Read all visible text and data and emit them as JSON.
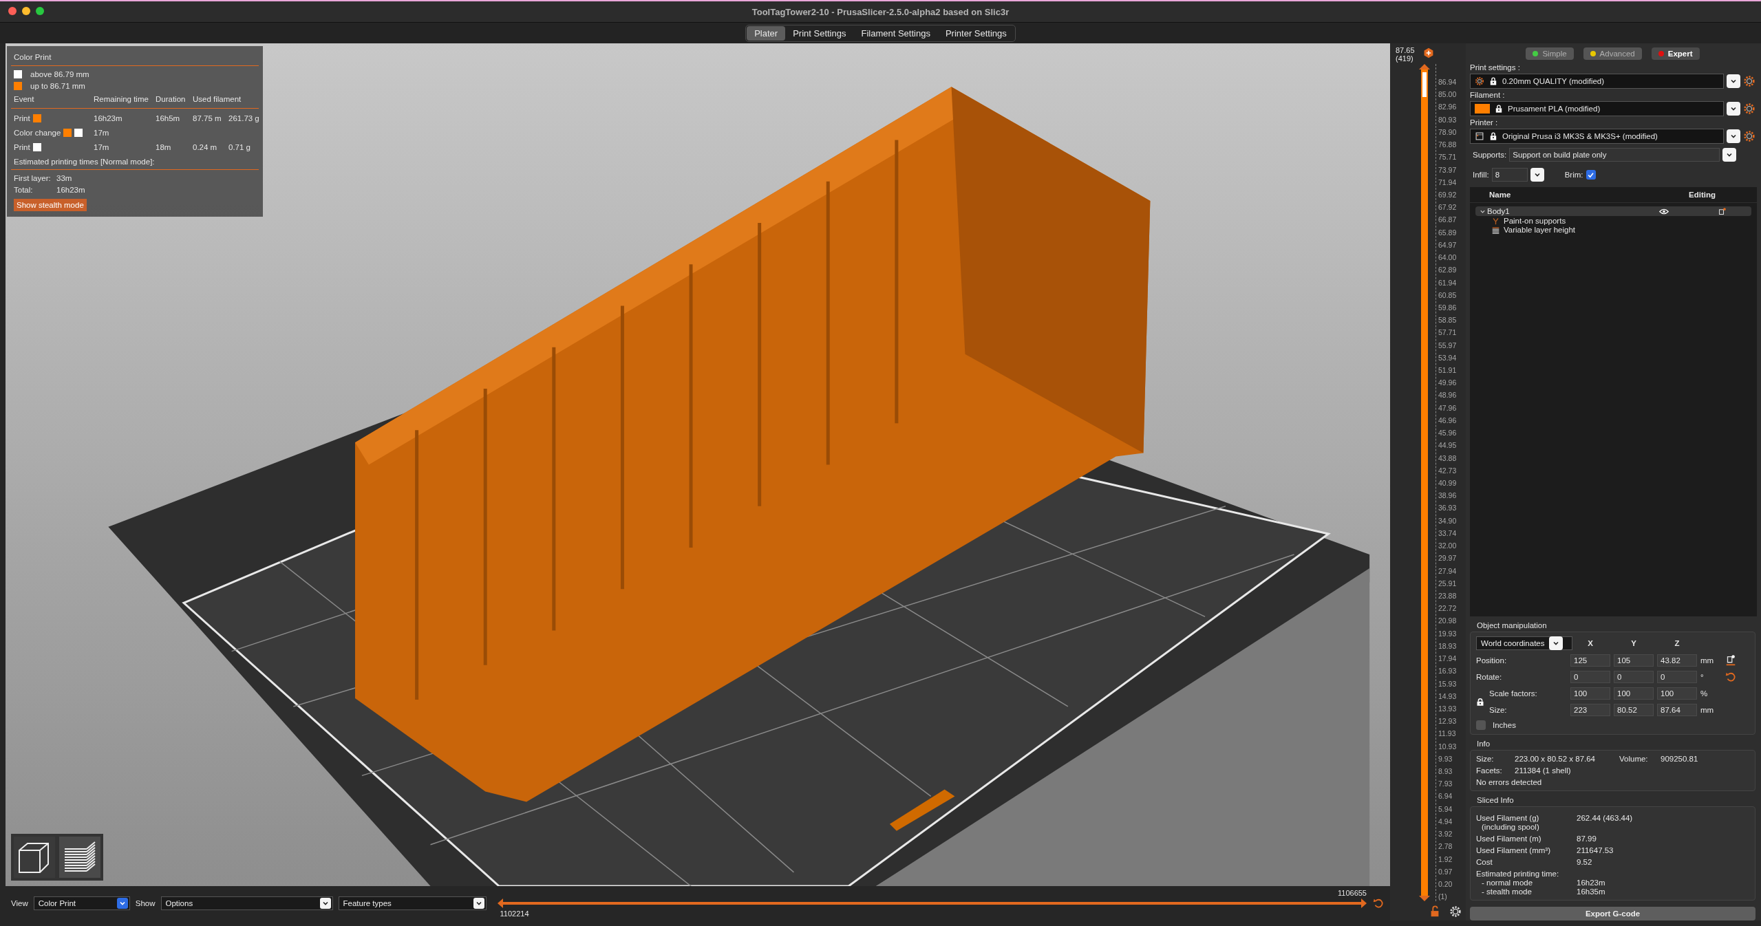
{
  "window": {
    "title": "ToolTagTower2-10 - PrusaSlicer-2.5.0-alpha2 based on Slic3r"
  },
  "tabs": [
    {
      "label": "Plater",
      "selected": true
    },
    {
      "label": "Print Settings",
      "selected": false
    },
    {
      "label": "Filament Settings",
      "selected": false
    },
    {
      "label": "Printer Settings",
      "selected": false
    }
  ],
  "legend": {
    "title": "Color Print",
    "ranges": [
      {
        "label": "above 86.79 mm",
        "color": "#ffffff"
      },
      {
        "label": "up to 86.71 mm",
        "color": "#ff7f00"
      }
    ],
    "columns": [
      "Event",
      "Remaining time",
      "Duration",
      "Used filament"
    ],
    "rows": [
      {
        "event": "Print",
        "swatches": [
          {
            "color": "#ff7f00"
          }
        ],
        "remaining": "16h23m",
        "duration": "16h5m",
        "length": "87.75 m",
        "weight": "261.73 g"
      },
      {
        "event": "Color change",
        "swatches": [
          {
            "color": "#ff7f00"
          },
          {
            "color": "#ffffff"
          }
        ],
        "remaining": "17m"
      },
      {
        "event": "Print",
        "swatches": [
          {
            "color": "#ffffff"
          }
        ],
        "remaining": "17m",
        "duration": "18m",
        "length": "0.24 m",
        "weight": "0.71 g"
      }
    ],
    "estimate_title": "Estimated printing times [Normal mode]:",
    "times": [
      {
        "label": "First layer:",
        "value": "33m"
      },
      {
        "label": "Total:",
        "value": "16h23m"
      }
    ],
    "button": "Show stealth mode"
  },
  "bottom_bar": {
    "view_label": "View",
    "view_value": "Color Print",
    "show_label": "Show",
    "show_value": "Options",
    "feature_value": "Feature types",
    "slider": {
      "start": "1102214",
      "end": "1106655",
      "level": 1
    }
  },
  "layer_slider": {
    "top_value": "87.65",
    "top_layer": "(419)",
    "level": 1,
    "ticks": [
      "86.94",
      "85.00",
      "82.96",
      "80.93",
      "78.90",
      "76.88",
      "75.71",
      "73.97",
      "71.94",
      "69.92",
      "67.92",
      "66.87",
      "65.89",
      "64.97",
      "64.00",
      "62.89",
      "61.94",
      "60.85",
      "59.86",
      "58.85",
      "57.71",
      "55.97",
      "53.94",
      "51.91",
      "49.96",
      "48.96",
      "47.96",
      "46.96",
      "45.96",
      "44.95",
      "43.88",
      "42.73",
      "40.99",
      "38.96",
      "36.93",
      "34.90",
      "33.74",
      "32.00",
      "29.97",
      "27.94",
      "25.91",
      "23.88",
      "22.72",
      "20.98",
      "19.93",
      "18.93",
      "17.94",
      "16.93",
      "15.93",
      "14.93",
      "13.93",
      "12.93",
      "11.93",
      "10.93",
      "9.93",
      "8.93",
      "7.93",
      "6.94",
      "5.94",
      "4.94",
      "3.92",
      "2.78",
      "1.92",
      "0.97",
      "0.20"
    ],
    "bottom_layer": "(1)"
  },
  "modes": [
    {
      "label": "Simple",
      "color": "#44cc44",
      "selected": false
    },
    {
      "label": "Advanced",
      "color": "#e8c800",
      "selected": false
    },
    {
      "label": "Expert",
      "color": "#e01010",
      "selected": true
    }
  ],
  "presets": [
    {
      "kind": "print",
      "label": "Print settings :",
      "value": "0.20mm QUALITY (modified)"
    },
    {
      "kind": "filament",
      "label": "Filament :",
      "value": "Prusament PLA (modified)",
      "color": "#ff7f00"
    },
    {
      "kind": "printer",
      "label": "Printer :",
      "value": "Original Prusa i3 MK3S & MK3S+ (modified)"
    }
  ],
  "supports": {
    "label": "Supports:",
    "value": "Support on build plate only"
  },
  "infill": {
    "label": "Infill:",
    "value": "8"
  },
  "brim": {
    "label": "Brim:",
    "checked": true
  },
  "object_list": {
    "columns": [
      "Name",
      "Editing"
    ],
    "items": [
      {
        "name": "Body1",
        "expanded": true,
        "children": [
          {
            "name": "Paint-on supports",
            "kind": "paint"
          },
          {
            "name": "Variable layer height",
            "kind": "layers"
          }
        ]
      }
    ]
  },
  "manipulation": {
    "title": "Object manipulation",
    "coordinates": "World coordinates",
    "axes": [
      "X",
      "Y",
      "Z"
    ],
    "rows": [
      {
        "kind": "plain",
        "label": "Position:",
        "values": [
          "125",
          "105",
          "43.82"
        ],
        "unit": "mm"
      },
      {
        "kind": "plain",
        "label": "Rotate:",
        "values": [
          "0",
          "0",
          "0"
        ],
        "unit": "°"
      },
      {
        "kind": "locked",
        "label": "Scale factors:",
        "values": [
          "100",
          "100",
          "100"
        ],
        "unit": "%"
      },
      {
        "kind": "locked",
        "label": "Size:",
        "values": [
          "223",
          "80.52",
          "87.64"
        ],
        "unit": "mm"
      }
    ],
    "inches": {
      "label": "Inches",
      "checked": false
    }
  },
  "info": {
    "title": "Info",
    "size_label": "Size:",
    "size": "223.00 x 80.52 x 87.64",
    "volume_label": "Volume:",
    "volume": "909250.81",
    "facets_label": "Facets:",
    "facets": "211384 (1 shell)",
    "status": "No errors detected"
  },
  "sliced_info": {
    "title": "Sliced Info",
    "rows": [
      {
        "kind": "main",
        "label": "Used Filament (g)",
        "value": "262.44 (463.44)"
      },
      {
        "kind": "sub",
        "label": "(including spool)"
      },
      {
        "kind": "main",
        "label": "Used Filament (m)",
        "value": "87.99"
      },
      {
        "kind": "main",
        "label": "Used Filament (mm³)",
        "value": "211647.53"
      },
      {
        "kind": "main",
        "label": "Cost",
        "value": "9.52"
      },
      {
        "kind": "main",
        "label": "Estimated printing time:"
      },
      {
        "kind": "sub",
        "label": "- normal mode",
        "value": "16h23m"
      },
      {
        "kind": "sub",
        "label": "- stealth mode",
        "value": "16h35m"
      }
    ]
  },
  "export_button": "Export G-code"
}
